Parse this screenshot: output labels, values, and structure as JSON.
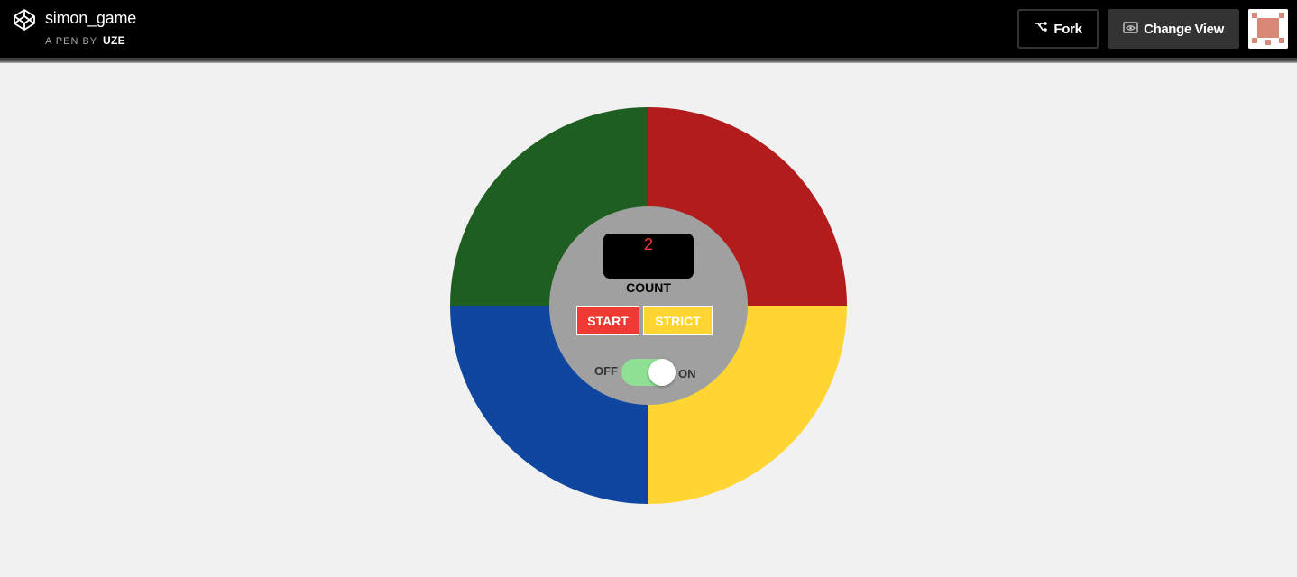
{
  "header": {
    "logo_icon": "codepen-logo-icon",
    "title": "simon_game",
    "by_prefix": "A PEN BY",
    "author": "UZE",
    "fork_label": "Fork",
    "fork_icon": "fork-icon",
    "change_view_label": "Change View",
    "change_view_icon": "eye-window-icon",
    "avatar_icon": "user-avatar-icon"
  },
  "game": {
    "colors": {
      "green": "#1e5e20",
      "red": "#b31c1c",
      "blue": "#0e46a0",
      "yellow": "#fed533",
      "center": "#a0a0a0"
    },
    "count_value": "2",
    "count_label": "COUNT",
    "start_label": "START",
    "strict_label": "STRICT",
    "off_label": "OFF",
    "on_label": "ON",
    "power_on": true
  }
}
